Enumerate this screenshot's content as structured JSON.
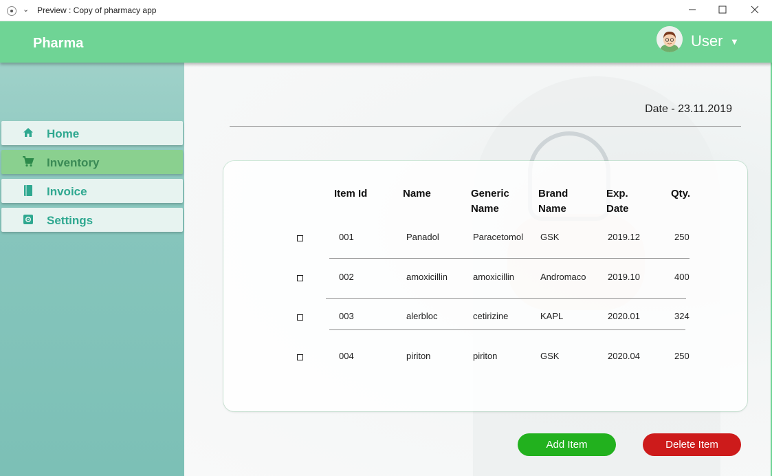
{
  "window": {
    "title": "Preview : Copy of pharmacy app",
    "controls": {
      "minimize": "—",
      "maximize": "☐",
      "close": "✕"
    }
  },
  "header": {
    "brand": "Pharma",
    "user_label": "User",
    "caret": "▼"
  },
  "sidebar": {
    "items": [
      {
        "label": "Home",
        "icon": "home-icon",
        "active": false
      },
      {
        "label": "Inventory",
        "icon": "cart-icon",
        "active": true
      },
      {
        "label": "Invoice",
        "icon": "book-icon",
        "active": false
      },
      {
        "label": "Settings",
        "icon": "settings-icon",
        "active": false
      }
    ]
  },
  "main": {
    "date": "Date - 23.11.2019",
    "table": {
      "headers": {
        "item_id": "Item Id",
        "name": "Name",
        "generic_1": "Generic",
        "generic_2": "Name",
        "brand_1": "Brand",
        "brand_2": "Name",
        "exp_1": "Exp.",
        "exp_2": "Date",
        "qty": "Qty."
      },
      "rows": [
        {
          "id": "001",
          "name": "Panadol",
          "generic": "Paracetomol",
          "brand": "GSK",
          "exp": "2019.12",
          "qty": "250"
        },
        {
          "id": "002",
          "name": "amoxicillin",
          "generic": "amoxicillin",
          "brand": "Andromaco",
          "exp": "2019.10",
          "qty": "400"
        },
        {
          "id": "003",
          "name": "alerbloc",
          "generic": "cetirizine",
          "brand": "KAPL",
          "exp": "2020.01",
          "qty": "324"
        },
        {
          "id": "004",
          "name": "piriton",
          "generic": "piriton",
          "brand": "GSK",
          "exp": "2020.04",
          "qty": "250"
        }
      ]
    },
    "buttons": {
      "add": "Add Item",
      "delete": "Delete Item"
    }
  },
  "colors": {
    "header": "#6fd495",
    "sidebar": "#86c5bc",
    "nav_active": "#8ad08f",
    "nav_text": "#2fa890",
    "add_button": "#22b11e",
    "delete_button": "#cd1b1b"
  }
}
